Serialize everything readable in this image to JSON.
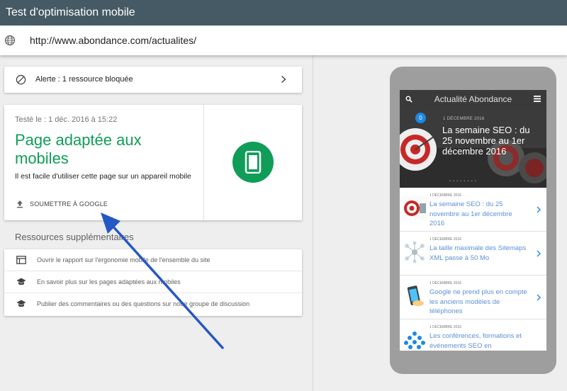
{
  "header": {
    "title": "Test d'optimisation mobile"
  },
  "urlbar": {
    "url": "http://www.abondance.com/actualites/",
    "icon": "globe-icon"
  },
  "alert": {
    "text": "Alerte : 1 ressource bloquée",
    "icon": "block-icon"
  },
  "result": {
    "tested_on": "Testé le : 1 déc. 2016 à 15:22",
    "title": "Page adaptée aux mobiles",
    "description": "Il est facile d'utiliser cette page sur un appareil mobile",
    "submit_label": "SOUMETTRE À GOOGLE",
    "status_color": "#0f9d58"
  },
  "resources": {
    "heading": "Ressources supplémentaires",
    "items": [
      {
        "label": "Ouvrir le rapport sur l'ergonomie mobile de l'ensemble du site",
        "icon": "report-icon"
      },
      {
        "label": "En savoir plus sur les pages adaptées aux mobiles",
        "icon": "school-icon"
      },
      {
        "label": "Publier des commentaires ou des questions sur notre groupe de discussion",
        "icon": "school-icon"
      }
    ]
  },
  "preview": {
    "site_title": "Actualité Abondance",
    "hero": {
      "badge": "0",
      "date": "1 DÉCEMBRE 2016",
      "title": "La semaine SEO : du 25 novembre au 1er décembre 2016",
      "dots": "• • • • • • • •"
    },
    "articles": [
      {
        "date": "1 DÉCEMBRE 2016",
        "title": "La semaine SEO : du 25 novembre au 1er décembre 2016",
        "thumb": "target-icon"
      },
      {
        "date": "1 DÉCEMBRE 2016",
        "title": "La taille maximale des Sitemaps XML passe à 50 Mo",
        "thumb": "sitemap-icon"
      },
      {
        "date": "1 DÉCEMBRE 2016",
        "title": "Google ne prend plus en compte les anciens modèles de téléphones",
        "thumb": "phone-icon"
      },
      {
        "date": "1 DÉCEMBRE 2016",
        "title": "Les conférences, formations et événements SEO en",
        "thumb": "people-icon"
      }
    ]
  },
  "colors": {
    "titlebar": "#455a64",
    "success": "#0f9d58",
    "arrow": "#2458c4",
    "link": "#5c8fd6"
  }
}
